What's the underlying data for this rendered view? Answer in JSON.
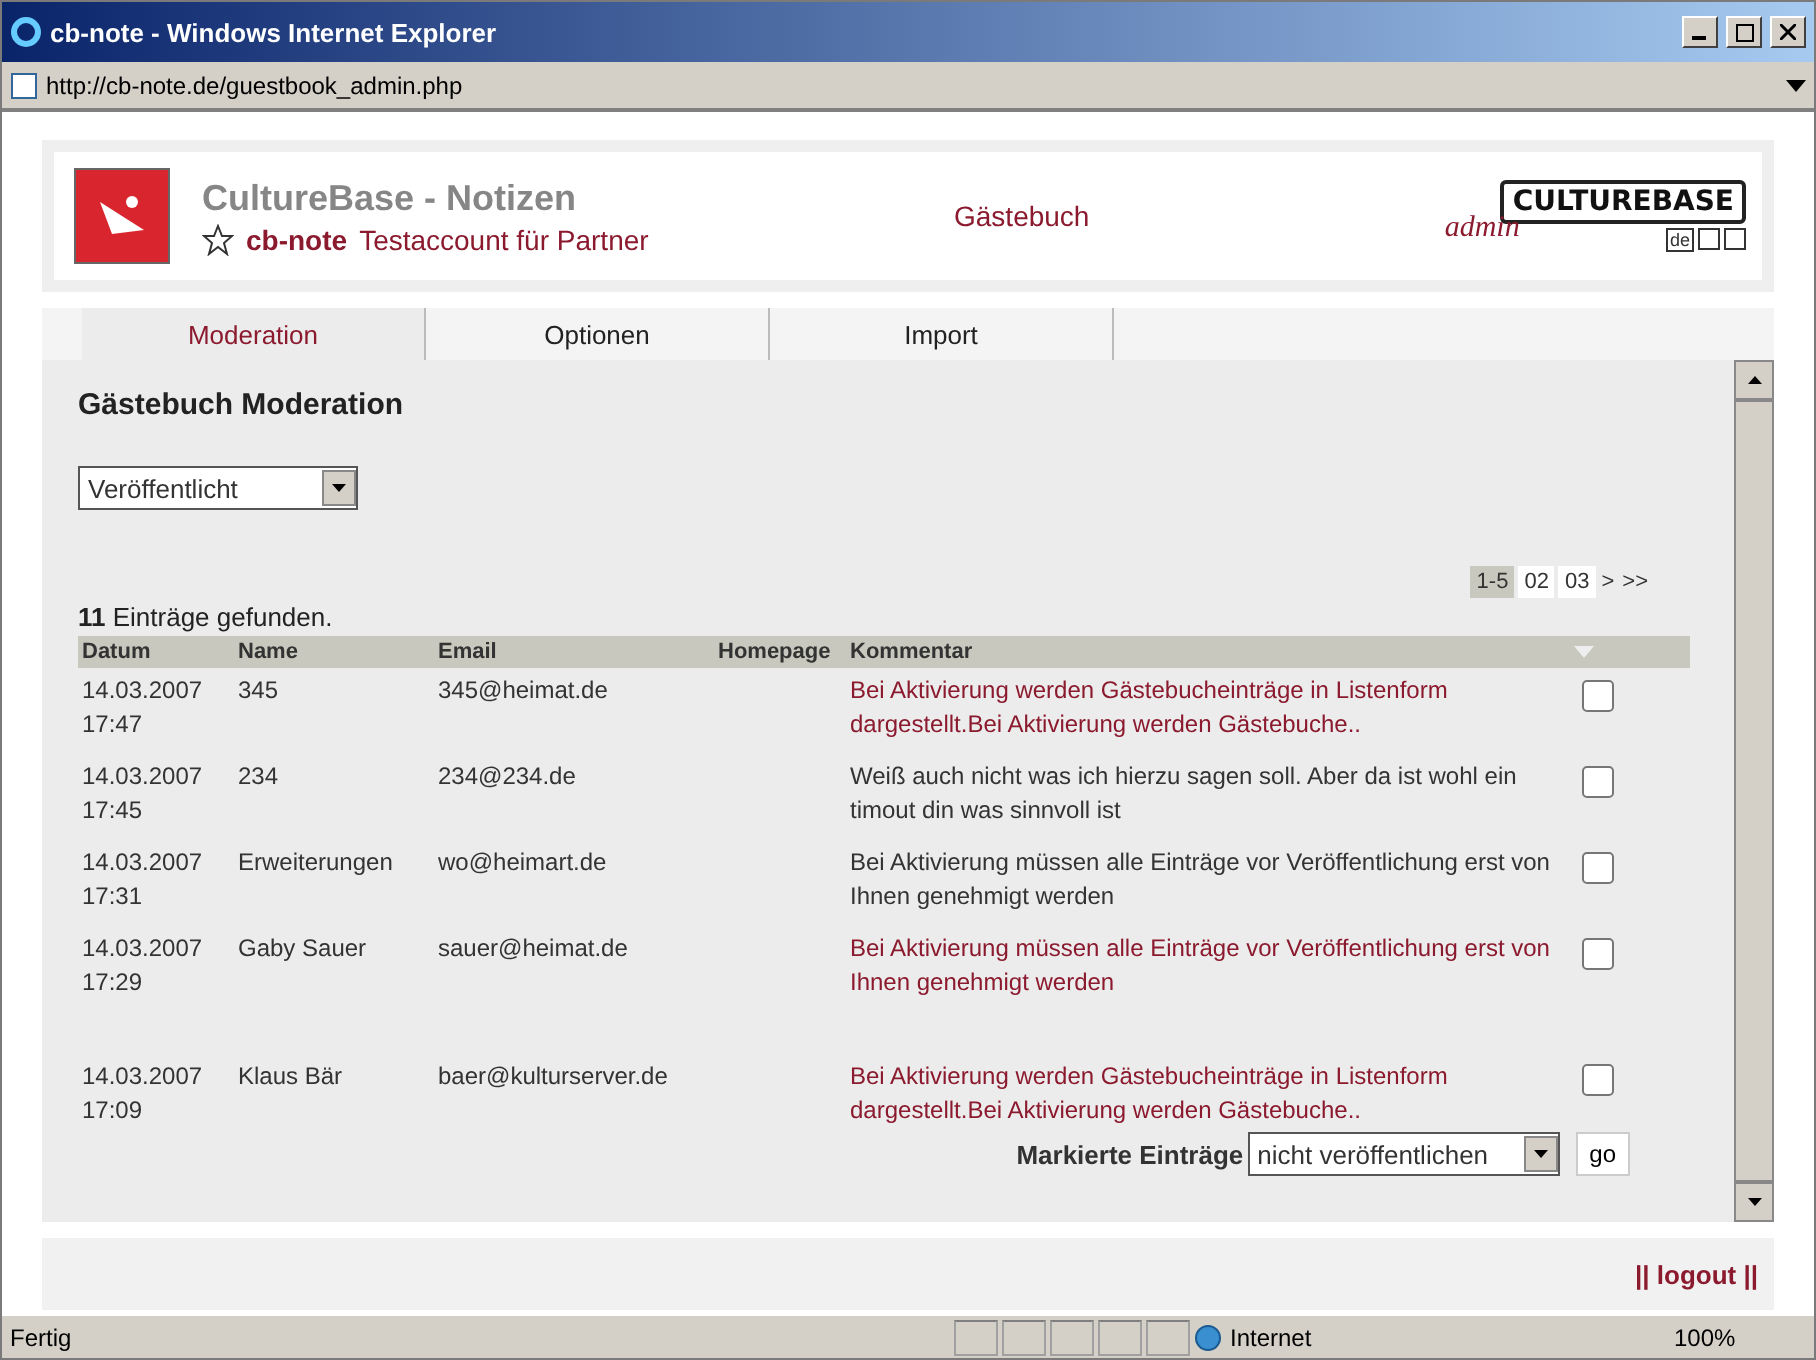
{
  "window": {
    "title": "cb-note - Windows Internet Explorer",
    "address": "http://cb-note.de/guestbook_admin.php"
  },
  "header": {
    "title": "CultureBase - Notizen",
    "app": "cb-note",
    "account": "Testaccount für Partner",
    "section": "Gästebuch",
    "brand": "CULTUREBASE",
    "brand_script": "admin",
    "language": "de"
  },
  "tabs": [
    {
      "label": "Moderation",
      "selected": true
    },
    {
      "label": "Optionen",
      "selected": false
    },
    {
      "label": "Import",
      "selected": false
    }
  ],
  "heading": "Gästebuch Moderation",
  "filter": {
    "value": "Veröffentlicht"
  },
  "pagination": [
    {
      "label": "1-5",
      "selected": true
    },
    {
      "label": "02",
      "selected": false
    },
    {
      "label": "03",
      "selected": false
    },
    {
      "label": ">",
      "selected": false
    },
    {
      "label": ">>",
      "selected": false
    }
  ],
  "result": "**11** Einträge gefunden.",
  "table": {
    "columns": [
      "Datum",
      "Name",
      "Email",
      "Homepage",
      "Kommentar"
    ],
    "rows": [
      {
        "date": "14.03.2007",
        "time": "17:47",
        "name": "345",
        "email": "345@heimat.de",
        "comment": "Bei Aktivierung werden Gästebucheinträge in Listenform dargestellt.Bei Aktivierung werden Gästebuche..",
        "color": "#8b1a2e",
        "checked": false
      },
      {
        "date": "14.03.2007",
        "time": "17:45",
        "name": "234",
        "email": "234@234.de",
        "comment": "Weiß auch nicht was ich hierzu sagen soll. Aber da ist wohl ein timout din was sinnvoll ist",
        "color": "#333333",
        "checked": false
      },
      {
        "date": "14.03.2007",
        "time": "17:31",
        "name": "Erweiterungen",
        "email": "wo@heimart.de",
        "comment": "Bei Aktivierung müssen alle Einträge vor Veröffentlichung erst von Ihnen genehmigt werden",
        "color": "#333333",
        "checked": false
      },
      {
        "date": "14.03.2007",
        "time": "17:29",
        "name": "Gaby Sauer",
        "email": "sauer@heimat.de",
        "comment": "Bei Aktivierung müssen alle Einträge vor Veröffentlichung erst von Ihnen genehmigt werden",
        "color": "#8b1a2e",
        "checked": false
      },
      {
        "date": "14.03.2007",
        "time": "17:09",
        "name": "Klaus Bär",
        "email": "baer@kulturserver.de",
        "comment": "Bei Aktivierung werden Gästebucheinträge in Listenform dargestellt.Bei Aktivierung werden Gästebuche..",
        "color": "#8b1a2e",
        "checked": false
      }
    ]
  },
  "bulk": {
    "label": "Markierte Einträge",
    "value": "nicht veröffentlichen",
    "button": "go"
  },
  "footer": {
    "logout": "|| logout ||"
  },
  "status_bar": {
    "text": "Fertig",
    "zone": "Internet",
    "zoom": "100%"
  }
}
